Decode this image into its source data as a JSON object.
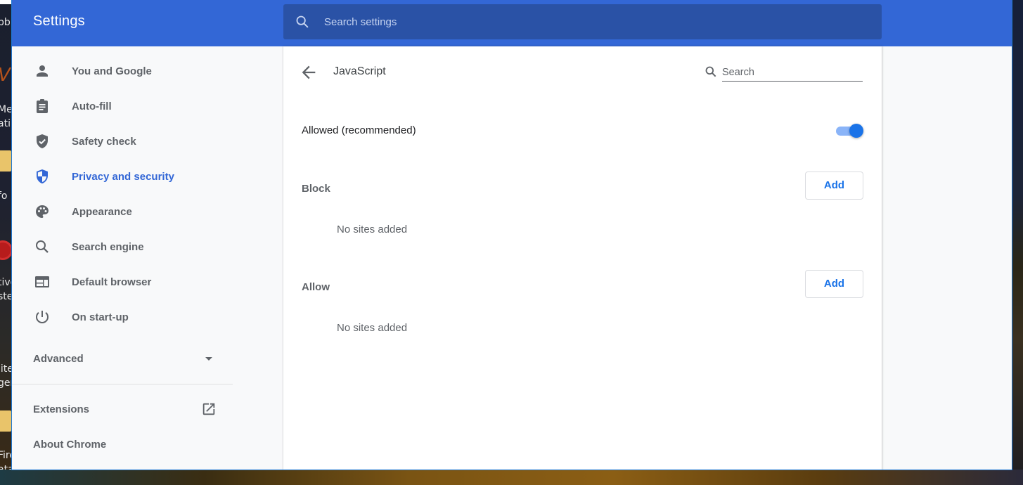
{
  "window": {
    "header_title": "Settings",
    "search_placeholder": "Search settings"
  },
  "sidebar": {
    "items": [
      {
        "label": "You and Google",
        "icon": "person-icon",
        "active": false
      },
      {
        "label": "Auto-fill",
        "icon": "clipboard-icon",
        "active": false
      },
      {
        "label": "Safety check",
        "icon": "shield-check-icon",
        "active": false
      },
      {
        "label": "Privacy and security",
        "icon": "shield-privacy-icon",
        "active": true
      },
      {
        "label": "Appearance",
        "icon": "palette-icon",
        "active": false
      },
      {
        "label": "Search engine",
        "icon": "search-icon",
        "active": false
      },
      {
        "label": "Default browser",
        "icon": "browser-window-icon",
        "active": false
      },
      {
        "label": "On start-up",
        "icon": "power-icon",
        "active": false
      }
    ],
    "advanced_label": "Advanced",
    "extensions_label": "Extensions",
    "about_label": "About Chrome"
  },
  "content": {
    "page_title": "JavaScript",
    "search_placeholder": "Search",
    "allowed_label": "Allowed (recommended)",
    "allowed_enabled": true,
    "block": {
      "label": "Block",
      "add_label": "Add",
      "empty_message": "No sites added"
    },
    "allow": {
      "label": "Allow",
      "add_label": "Add",
      "empty_message": "No sites added"
    }
  },
  "colors": {
    "header": "#3367d6",
    "search_bar": "#2a52a6",
    "accent": "#1a73e8",
    "active_nav": "#3367d6",
    "sidebar_bg": "#f8f9fa",
    "toggle_track": "#8ab4f8"
  },
  "desktop": {
    "partial_labels": [
      "pb",
      "Me",
      "ati",
      "fo",
      "tive",
      "ste",
      "lite",
      "ger",
      "Fire",
      "ata"
    ]
  }
}
